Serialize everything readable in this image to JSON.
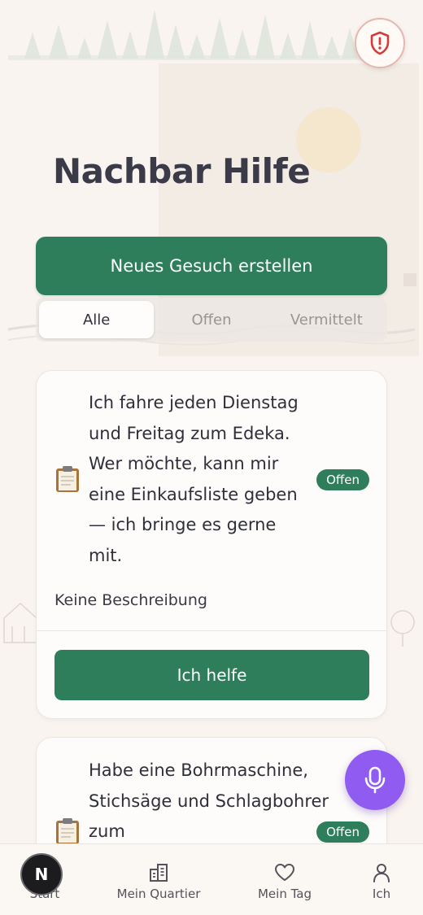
{
  "app": {
    "title": "Nachbar Hilfe"
  },
  "actions": {
    "create_label": "Neues Gesuch erstellen"
  },
  "tabs": [
    {
      "label": "Alle",
      "active": true
    },
    {
      "label": "Offen",
      "active": false
    },
    {
      "label": "Vermittelt",
      "active": false
    }
  ],
  "cards": [
    {
      "icon": "clipboard-icon",
      "text": "Ich fahre jeden Dienstag und Freitag zum Edeka. Wer möchte, kann mir eine Einkaufsliste geben — ich bringe es gerne mit.",
      "status": "Offen",
      "description": "Keine Beschreibung",
      "button": "Ich helfe"
    },
    {
      "icon": "clipboard-icon",
      "text": "Habe eine Bohrmaschine, Stichsäge und Schlagbohrer zum",
      "status": "Offen"
    }
  ],
  "nav": {
    "items": [
      {
        "label": "Start",
        "icon": "home-icon"
      },
      {
        "label": "Mein Quartier",
        "icon": "building-icon"
      },
      {
        "label": "Mein Tag",
        "icon": "heart-icon"
      },
      {
        "label": "Ich",
        "icon": "person-icon"
      }
    ],
    "avatar_letter": "N"
  },
  "colors": {
    "primary": "#2e7d5b",
    "background": "#f9f4ef",
    "mic": "#8f5bf0",
    "alert": "#d23c3c"
  }
}
